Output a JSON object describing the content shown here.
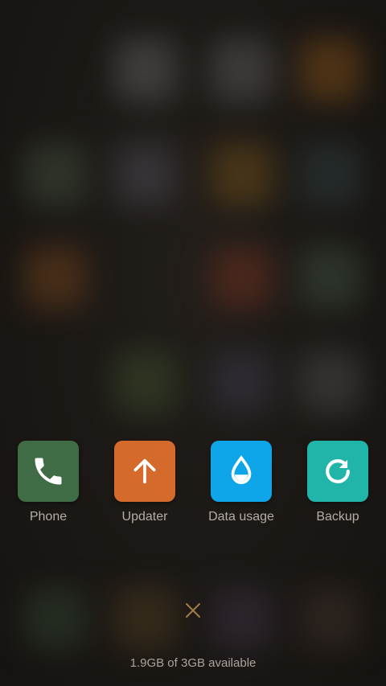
{
  "recent_apps": [
    {
      "label": "Phone",
      "icon": "phone-icon",
      "color": "#3f6b45"
    },
    {
      "label": "Updater",
      "icon": "arrow-up-icon",
      "color": "#d46a2c"
    },
    {
      "label": "Data usage",
      "icon": "water-drop-icon",
      "color": "#0ea5e9"
    },
    {
      "label": "Backup",
      "icon": "refresh-icon",
      "color": "#20b5a8"
    }
  ],
  "close_icon": "close-icon",
  "close_color": "#a37d4b",
  "memory_status": "1.9GB of 3GB available"
}
